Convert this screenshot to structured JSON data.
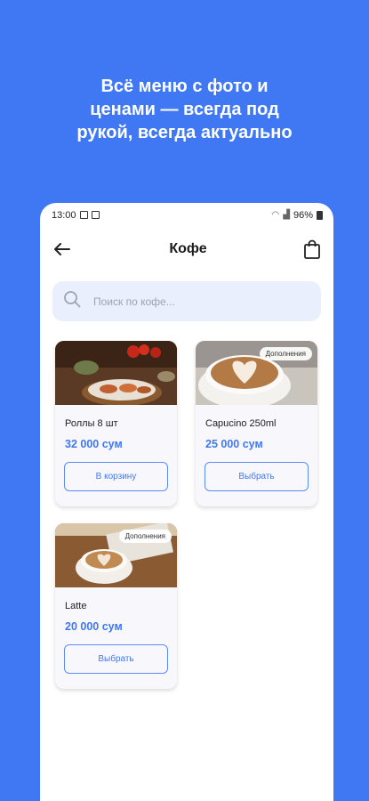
{
  "promo": {
    "line1": "Всё меню с фото и",
    "line2": "ценами — всегда под",
    "line3": "рукой, всегда актуально"
  },
  "status": {
    "time": "13:00",
    "battery": "96%"
  },
  "header": {
    "title": "Кофе"
  },
  "search": {
    "placeholder": "Поиск по кофе..."
  },
  "products": [
    {
      "name": "Роллы 8 шт",
      "price": "32 000 сум",
      "button": "В корзину",
      "badge": ""
    },
    {
      "name": "Capucino 250ml",
      "price": "25 000 сум",
      "button": "Выбрать",
      "badge": "Дополнения"
    },
    {
      "name": "Latte",
      "price": "20 000 сум",
      "button": "Выбрать",
      "badge": "Дополнения"
    }
  ],
  "colors": {
    "accent": "#3F78F2",
    "search_bg": "#E9EFFC",
    "card_bg": "#F8F7FB"
  },
  "icons": [
    "back-arrow-icon",
    "shopping-bag-icon",
    "search-icon"
  ]
}
